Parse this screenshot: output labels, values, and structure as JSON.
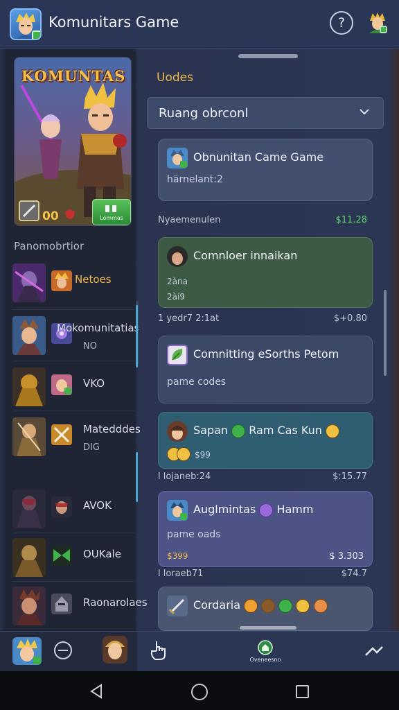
{
  "app": {
    "title": "Komunitars Game"
  },
  "banner": {
    "title": "KOMUNTAS",
    "count": "00",
    "cta": "Lommas"
  },
  "left": {
    "section_label": "Panomobrtior",
    "items": [
      {
        "label": "Netoes",
        "sub": ""
      },
      {
        "label": "Mokomunitatias",
        "sub": "NO"
      },
      {
        "label": "VKO",
        "sub": ""
      },
      {
        "label": "Matedddes",
        "sub": "DIG"
      },
      {
        "label": "AVOK",
        "sub": ""
      },
      {
        "label": "OUKale",
        "sub": ""
      },
      {
        "label": "Raonarolaes",
        "sub": ""
      }
    ]
  },
  "right": {
    "heading": "Uodes",
    "dropdown": "Ruang obrconl",
    "cards": [
      {
        "title": "Obnunitan Came Game",
        "sub": "härnelant:2"
      },
      {
        "title": "Comnloer innaikan",
        "sub1": "2àna",
        "sub2": "2àí9"
      },
      {
        "title": "Comnitting eSorths Petom",
        "sub": "pame codes"
      },
      {
        "title": "Sapan",
        "title2": "Ram Cas Kun",
        "sub": "$99"
      },
      {
        "title": "Auglmintas",
        "title2": "Hamm",
        "sub": "pame oads",
        "price_left": "$399",
        "price_right": "$ 3.303"
      },
      {
        "title": "Cordaria"
      }
    ],
    "meta": [
      {
        "left": "Nyaemenulen",
        "right": "$11.28"
      },
      {
        "left": "1 yedr7 2:1at",
        "right": "$+0.80"
      },
      {
        "left": "l lojaneb:24",
        "right": "$:15.77"
      },
      {
        "left": "l loraeb71",
        "right": "$74.7"
      }
    ]
  },
  "bottom_nav": {
    "center_label": "Oveneesno"
  },
  "colors": {
    "accent": "#f0b94a",
    "price_green": "#5fd36a",
    "card_green": "#3d5a44",
    "card_teal": "#2f5d72",
    "card_purple": "#4d5485"
  }
}
